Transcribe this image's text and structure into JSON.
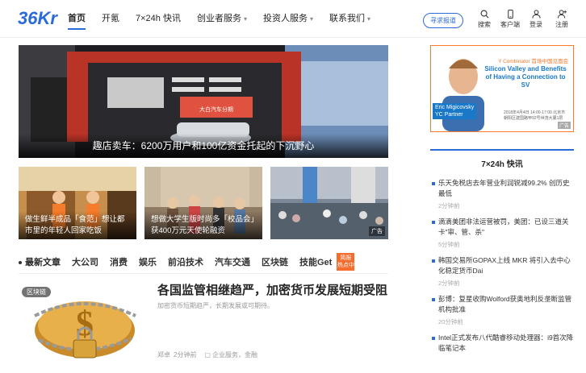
{
  "logo": "36Kr",
  "nav": [
    {
      "label": "首页",
      "active": true,
      "dropdown": false
    },
    {
      "label": "开氪",
      "active": false,
      "dropdown": false
    },
    {
      "label": "7×24h 快讯",
      "active": false,
      "dropdown": false
    },
    {
      "label": "创业者服务",
      "active": false,
      "dropdown": true
    },
    {
      "label": "投资人服务",
      "active": false,
      "dropdown": true
    },
    {
      "label": "联系我们",
      "active": false,
      "dropdown": true
    }
  ],
  "report_button": "寻求报道",
  "tools": [
    {
      "label": "搜索",
      "icon": "search-icon"
    },
    {
      "label": "客户端",
      "icon": "phone-icon"
    },
    {
      "label": "登录",
      "icon": "user-icon"
    },
    {
      "label": "注册",
      "icon": "user-add-icon"
    }
  ],
  "hero": {
    "caption": "趣店卖车：6200万用户和100亿资金托起的下沉野心",
    "sign": "大白汽车分期"
  },
  "thumbs": [
    {
      "caption": "做生鲜半成品「食范」想让都市里的年轻人回家吃饭",
      "ad": ""
    },
    {
      "caption": "想做大学生版时尚多「校品会」获400万元天使轮融资",
      "ad": ""
    },
    {
      "caption": "",
      "ad": "广告"
    }
  ],
  "tabs": [
    {
      "label": "最新文章",
      "active": true
    },
    {
      "label": "大公司"
    },
    {
      "label": "消费"
    },
    {
      "label": "娱乐"
    },
    {
      "label": "前沿技术"
    },
    {
      "label": "汽车交通"
    },
    {
      "label": "区块链"
    },
    {
      "label": "技能Get"
    }
  ],
  "tab_badge": "简报 热点中",
  "article": {
    "tag": "区块链",
    "title": "各国监管相继趋严，加密货币发展短期受阻",
    "desc": "加密货币短期趋严，长期发展或可期待。",
    "author": "郑卓",
    "time": "2分钟前",
    "category": "企业服务，金融"
  },
  "ad_right": {
    "yc": "Y Combinator 首场中国见面会",
    "headline": "Silicon Valley and Benefits of Having a Connection to SV",
    "speaker": "Eric Migicovsky",
    "speaker_role": "YC Partner",
    "date": "2018年4月4日 14:00-17:00 北京市朝阳区建国路甲92号世茂大厦1层",
    "ad_label": "广告"
  },
  "flash": {
    "heading": "7×24h 快讯",
    "items": [
      {
        "text": "乐天免税店去年营业利润锐减99.2% 创历史最低",
        "time": "2分钟前"
      },
      {
        "text": "滴滴美团非法运营被罚，美团：已设三道关卡\"审、管、杀\"",
        "time": "5分钟前"
      },
      {
        "text": "韩国交易所GOPAX上线 MKR 将引入去中心化稳定货币Dai",
        "time": "2分钟前"
      },
      {
        "text": "彭博：复星收购Wolford获奥地利反垄断监管机构批准",
        "time": "20分钟前"
      },
      {
        "text": "Intel正式发布八代酷睿移动处理器：i9首次降临笔记本",
        "time": ""
      }
    ]
  }
}
